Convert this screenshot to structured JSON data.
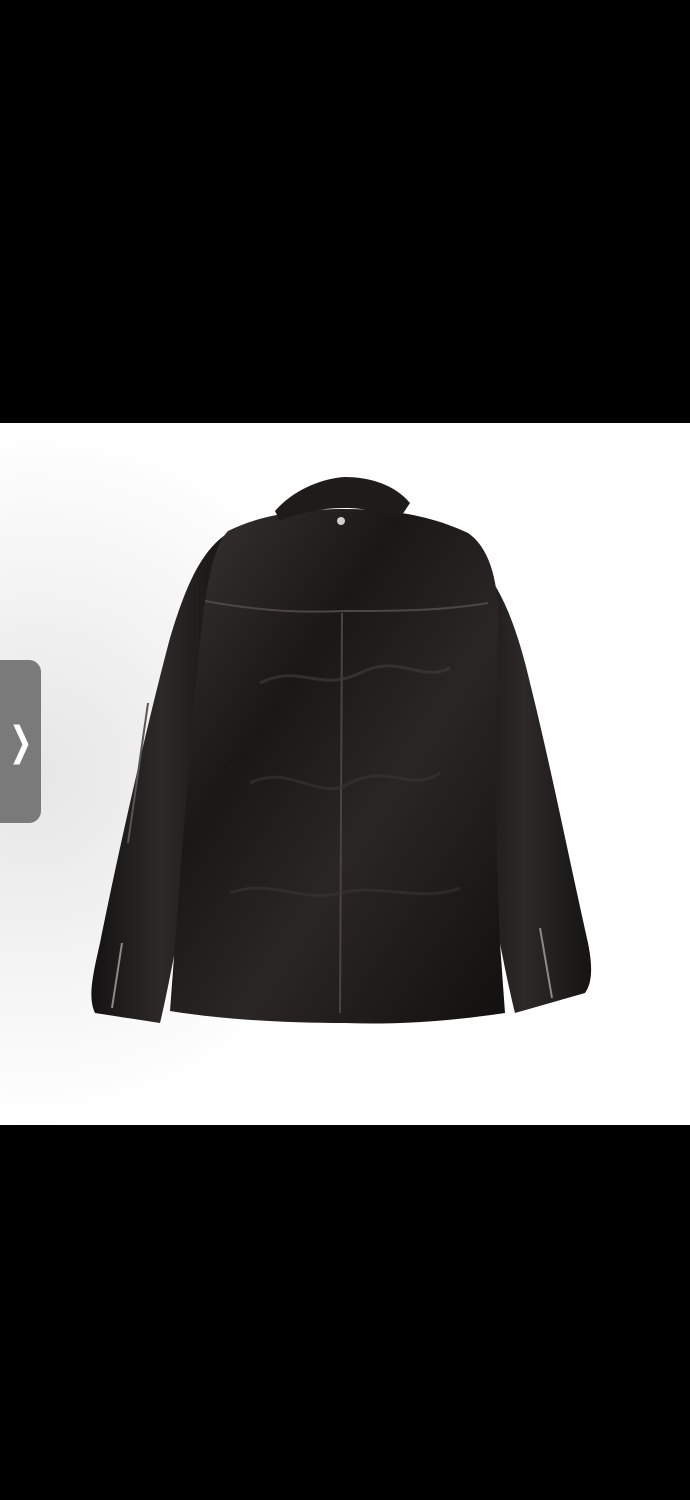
{
  "viewer": {
    "background_color": "#000000"
  },
  "photo": {
    "subject_icon": "leather-jacket-back-icon",
    "background_color": "#ffffff",
    "jacket_color": "#1a1717"
  },
  "navigation": {
    "next_icon": "chevron-right-icon",
    "next_glyph": "❯",
    "button_color": "#7a7a7a"
  }
}
